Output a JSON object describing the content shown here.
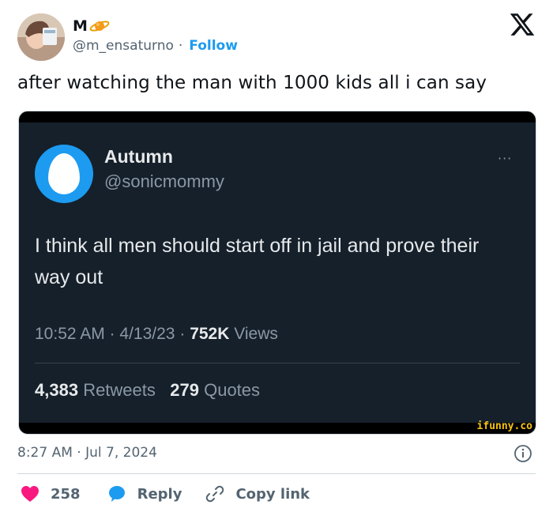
{
  "author": {
    "name": "M",
    "handle": "@m_ensaturno",
    "separator": "·",
    "follow_label": "Follow",
    "name_emoji": "planet-icon"
  },
  "post": {
    "text": "after watching the man with 1000 kids all i can say",
    "timestamp": "8:27 AM · Jul 7, 2024"
  },
  "embedded": {
    "name": "Autumn",
    "handle": "@sonicmommy",
    "more": "···",
    "text": "I think all men should start off in jail and prove their way out",
    "time": "10:52 AM",
    "date": "4/13/23",
    "sep": "·",
    "views_count": "752K",
    "views_label": "Views",
    "retweets_count": "4,383",
    "retweets_label": "Retweets",
    "quotes_count": "279",
    "quotes_label": "Quotes",
    "watermark": "ifunny.co"
  },
  "actions": {
    "likes": "258",
    "reply_label": "Reply",
    "copy_label": "Copy link"
  },
  "colors": {
    "accent": "#1d9bf0",
    "like": "#f91880",
    "dark_bg": "#15202b",
    "muted": "#536471"
  }
}
